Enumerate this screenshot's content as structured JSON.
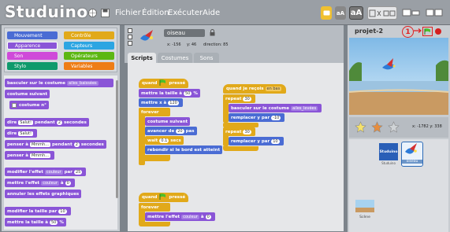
{
  "app": {
    "logo": "Studuino",
    "menu": [
      "Fichier",
      "Édition",
      "Exécuter",
      "Aide"
    ]
  },
  "colors": {
    "topbar": "#9a9fa5",
    "looks": "#8a55d7",
    "control": "#e1a91a",
    "highlight": "#e02020"
  },
  "categories": [
    {
      "label": "Mouvement",
      "color": "#4a6cd4"
    },
    {
      "label": "Contrôle",
      "color": "#e1a91a"
    },
    {
      "label": "Apparence",
      "color": "#8a55d7"
    },
    {
      "label": "Capteurs",
      "color": "#2ca5e2"
    },
    {
      "label": "Son",
      "color": "#cf4ad9"
    },
    {
      "label": "Opérateurs",
      "color": "#5cb712"
    },
    {
      "label": "Stylo",
      "color": "#0e9a6c"
    },
    {
      "label": "Variables",
      "color": "#ee7d16"
    }
  ],
  "palette": {
    "b1_text": "basculer sur le costume",
    "b1_dd": "ailes_baissées",
    "b2_text": "costume suivant",
    "b3_text": "costume n°",
    "b4_a": "dire",
    "b4_in": "Salut!",
    "b4_b": "pendant",
    "b4_num": "2",
    "b4_c": "secondes",
    "b5_a": "dire",
    "b5_in": "Salut!",
    "b6_a": "penser à",
    "b6_in": "Mmmh...",
    "b6_b": "pendant",
    "b6_num": "2",
    "b6_c": "secondes",
    "b7_a": "penser à",
    "b7_in": "Mmmh...",
    "b8_a": "modifier l'effet",
    "b8_dd": "couleur",
    "b8_b": "par",
    "b8_num": "25",
    "b9_a": "mettre l'effet",
    "b9_dd": "couleur",
    "b9_b": "à",
    "b9_num": "0",
    "b10_text": "annuler les effets graphiques",
    "b11_a": "modifier la taille par",
    "b11_num": "10",
    "b12_a": "mettre la taille à",
    "b12_num": "50",
    "b12_b": "%"
  },
  "sprite": {
    "name": "oiseau",
    "x": "x: -156",
    "y": "y: 46",
    "direction": "direction: 85"
  },
  "tabs": [
    "Scripts",
    "Costumes",
    "Sons"
  ],
  "script1": {
    "hat_a": "quand",
    "hat_b": "pressé",
    "l1_a": "mettre la taille à",
    "l1_num": "50",
    "l1_b": "%",
    "l2_a": "mettre x à",
    "l2_num": "120",
    "forever": "forever",
    "l3": "costume suivant",
    "l4_a": "avancer de",
    "l4_num": "20",
    "l4_b": "pas",
    "l5_a": "wait",
    "l5_num": "0.1",
    "l5_b": "secs",
    "l6": "rebondir si le bord est atteint"
  },
  "script2": {
    "hat_a": "quand je reçois",
    "hat_dd": "en bas",
    "r1_a": "repeat",
    "r1_num": "30",
    "i1_a": "basculer sur le costume",
    "i1_dd": "ailes_levées",
    "i2_a": "remplacer y par",
    "i2_num": "-10",
    "r2_a": "repeat",
    "r2_num": "30",
    "i3_a": "remplacer y par",
    "i3_num": "10"
  },
  "script3": {
    "hat_a": "quand",
    "hat_b": "pressé",
    "forever": "forever",
    "i1_a": "mettre l'effet",
    "i1_dd": "couleur",
    "i1_b": "à",
    "i1_num": "0"
  },
  "stage": {
    "title": "projet-2",
    "annotation": "1",
    "coords": "x: -1782  y: 338"
  },
  "sprite_list": [
    {
      "label": "Studuino"
    },
    {
      "label": "oiseau"
    }
  ],
  "scene_label": "Scène"
}
